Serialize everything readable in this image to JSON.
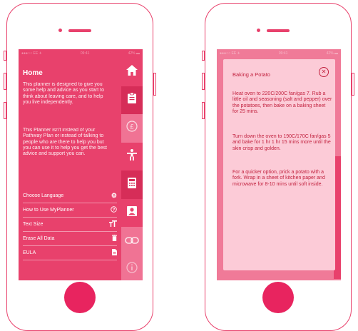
{
  "left_phone": {
    "status": {
      "carrier": "●●●○○ EE ✈",
      "time": "09:41",
      "battery": "42% ▬"
    },
    "menu": {
      "title": "Home",
      "paragraphs": [
        "This planner is designed to give you some help and advice as you start to think about leaving care, and to help you live independently.",
        "This Planner isn't instead of your Pathway Plan or instead of talking to people who are there to help you but you can use it to help you get the best advice and support you can."
      ],
      "items": [
        {
          "label": "Choose Language",
          "icon": "gear-icon"
        },
        {
          "label": "How to Use MyPlanner",
          "icon": "question-icon"
        },
        {
          "label": "Text Size",
          "icon": "text-size-icon"
        },
        {
          "label": "Erase All Data",
          "icon": "trash-icon"
        },
        {
          "label": "EULA",
          "icon": "document-icon"
        }
      ]
    },
    "rail": [
      "home-icon",
      "clipboard-icon",
      "pound-icon",
      "person-icon",
      "calculator-icon",
      "contact-icon",
      "link-icon",
      "info-icon"
    ]
  },
  "right_phone": {
    "status": {
      "carrier": "●●●○○ EE ✈",
      "time": "09:41",
      "battery": "42% ▬"
    },
    "dialog": {
      "title": "Baking a Potato",
      "paragraphs": [
        "Heat oven to 220C/200C fan/gas 7. Rub a little oil and seasoning (salt and pepper) over the potatoes, then bake on a baking sheet for 25 mins.",
        "Turn down the oven to 190C/170C fan/gas 5 and bake for 1 hr 1 hr 15 mins more until the skin crisp and golden.",
        "For a quicker option, prick a potato with a fork. Wrap in a sheet of kitchen paper and microwave for 8-10 mins until soft inside."
      ]
    }
  },
  "colors": {
    "accent": "#e8416c",
    "dark": "#d62d58",
    "light": "#f07394",
    "dialog": "#fccbd7",
    "dialog_text": "#c2223f",
    "home_button": "#e8245f"
  }
}
